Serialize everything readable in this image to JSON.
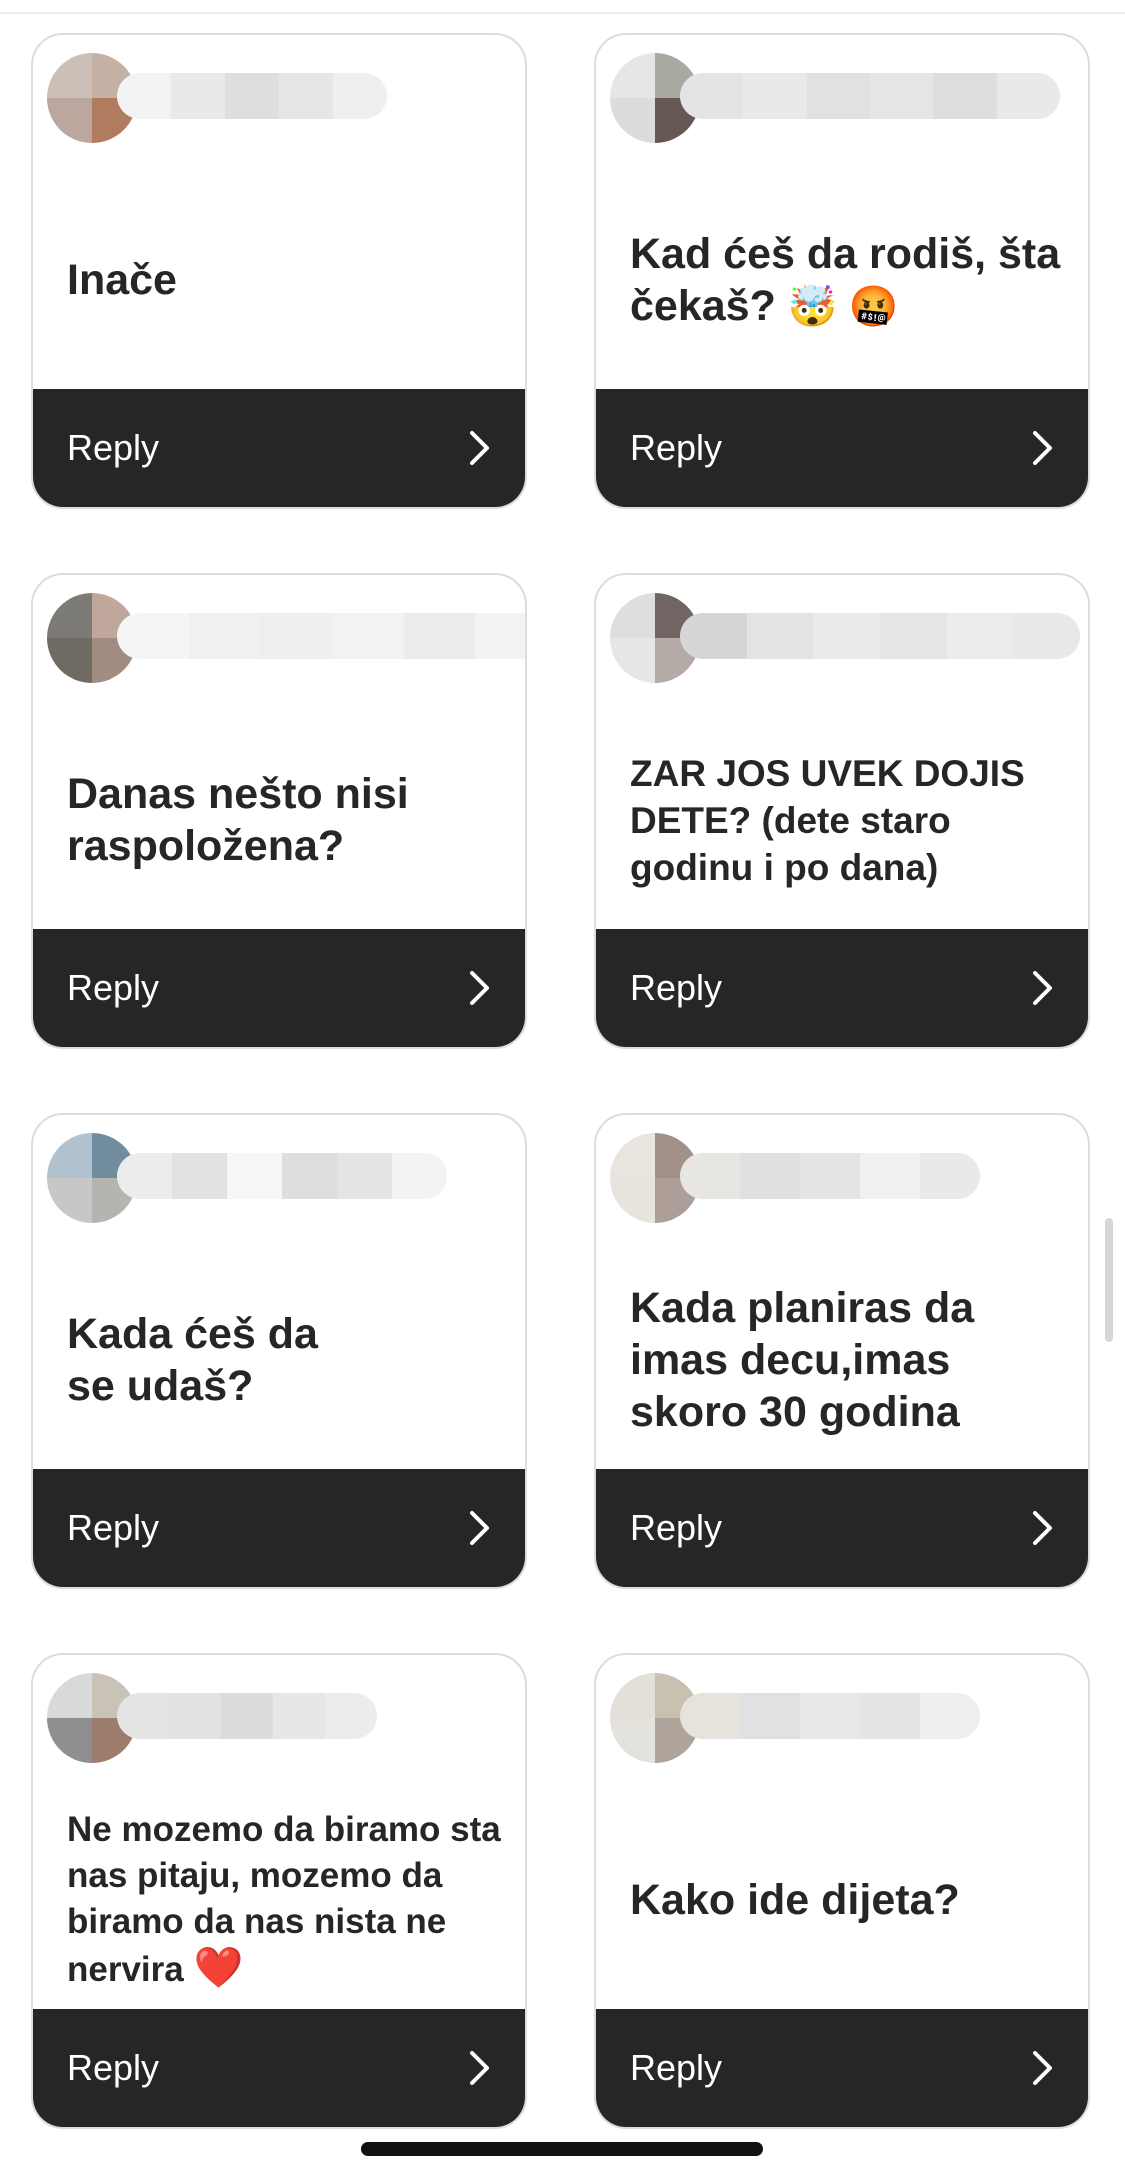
{
  "cards": [
    {
      "question": "Inače",
      "reply_label": "Reply",
      "emoji": ""
    },
    {
      "question": "Kad ćeš da rodiš, šta čekaš?",
      "reply_label": "Reply",
      "emoji": "🤯 🤬"
    },
    {
      "question": "Danas nešto nisi raspoložena?",
      "reply_label": "Reply",
      "emoji": ""
    },
    {
      "question": "ZAR JOS UVEK DOJIS DETE? (dete staro godinu i po dana)",
      "reply_label": "Reply",
      "emoji": ""
    },
    {
      "question": "Kada ćeš da se udaš?",
      "reply_label": "Reply",
      "emoji": ""
    },
    {
      "question": "Kada planiras da imas decu,imas skoro 30 godina",
      "reply_label": "Reply",
      "emoji": ""
    },
    {
      "question": "Ne mozemo da biramo sta nas pitaju, mozemo da biramo da nas nista ne nervira",
      "reply_label": "Reply",
      "emoji": "❤️"
    },
    {
      "question": "Kako ide dijeta?",
      "reply_label": "Reply",
      "emoji": ""
    }
  ]
}
